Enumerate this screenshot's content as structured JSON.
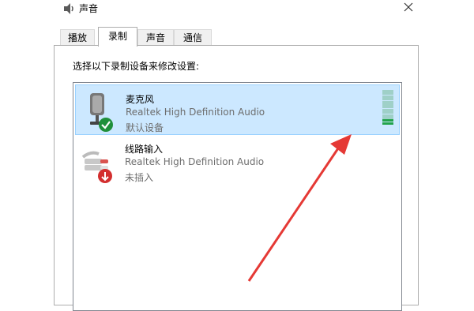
{
  "window": {
    "title": "声音",
    "title_icon": "speaker-icon",
    "close_icon": "close-icon"
  },
  "tabs": [
    {
      "label": "播放",
      "active": false
    },
    {
      "label": "录制",
      "active": true
    },
    {
      "label": "声音",
      "active": false
    },
    {
      "label": "通信",
      "active": false
    }
  ],
  "panel": {
    "instruction": "选择以下录制设备来修改设置:"
  },
  "devices": [
    {
      "name": "麦克风",
      "driver": "Realtek High Definition Audio",
      "status": "默认设备",
      "icon": "microphone-icon",
      "badge": "check-badge-icon",
      "selected": true,
      "level_segments_total": 13,
      "level_segments_active": 2
    },
    {
      "name": "线路输入",
      "driver": "Realtek High Definition Audio",
      "status": "未插入",
      "icon": "line-in-icon",
      "badge": "unplugged-badge-icon",
      "selected": false
    }
  ],
  "annotation": {
    "type": "arrow",
    "color": "#e53935"
  }
}
